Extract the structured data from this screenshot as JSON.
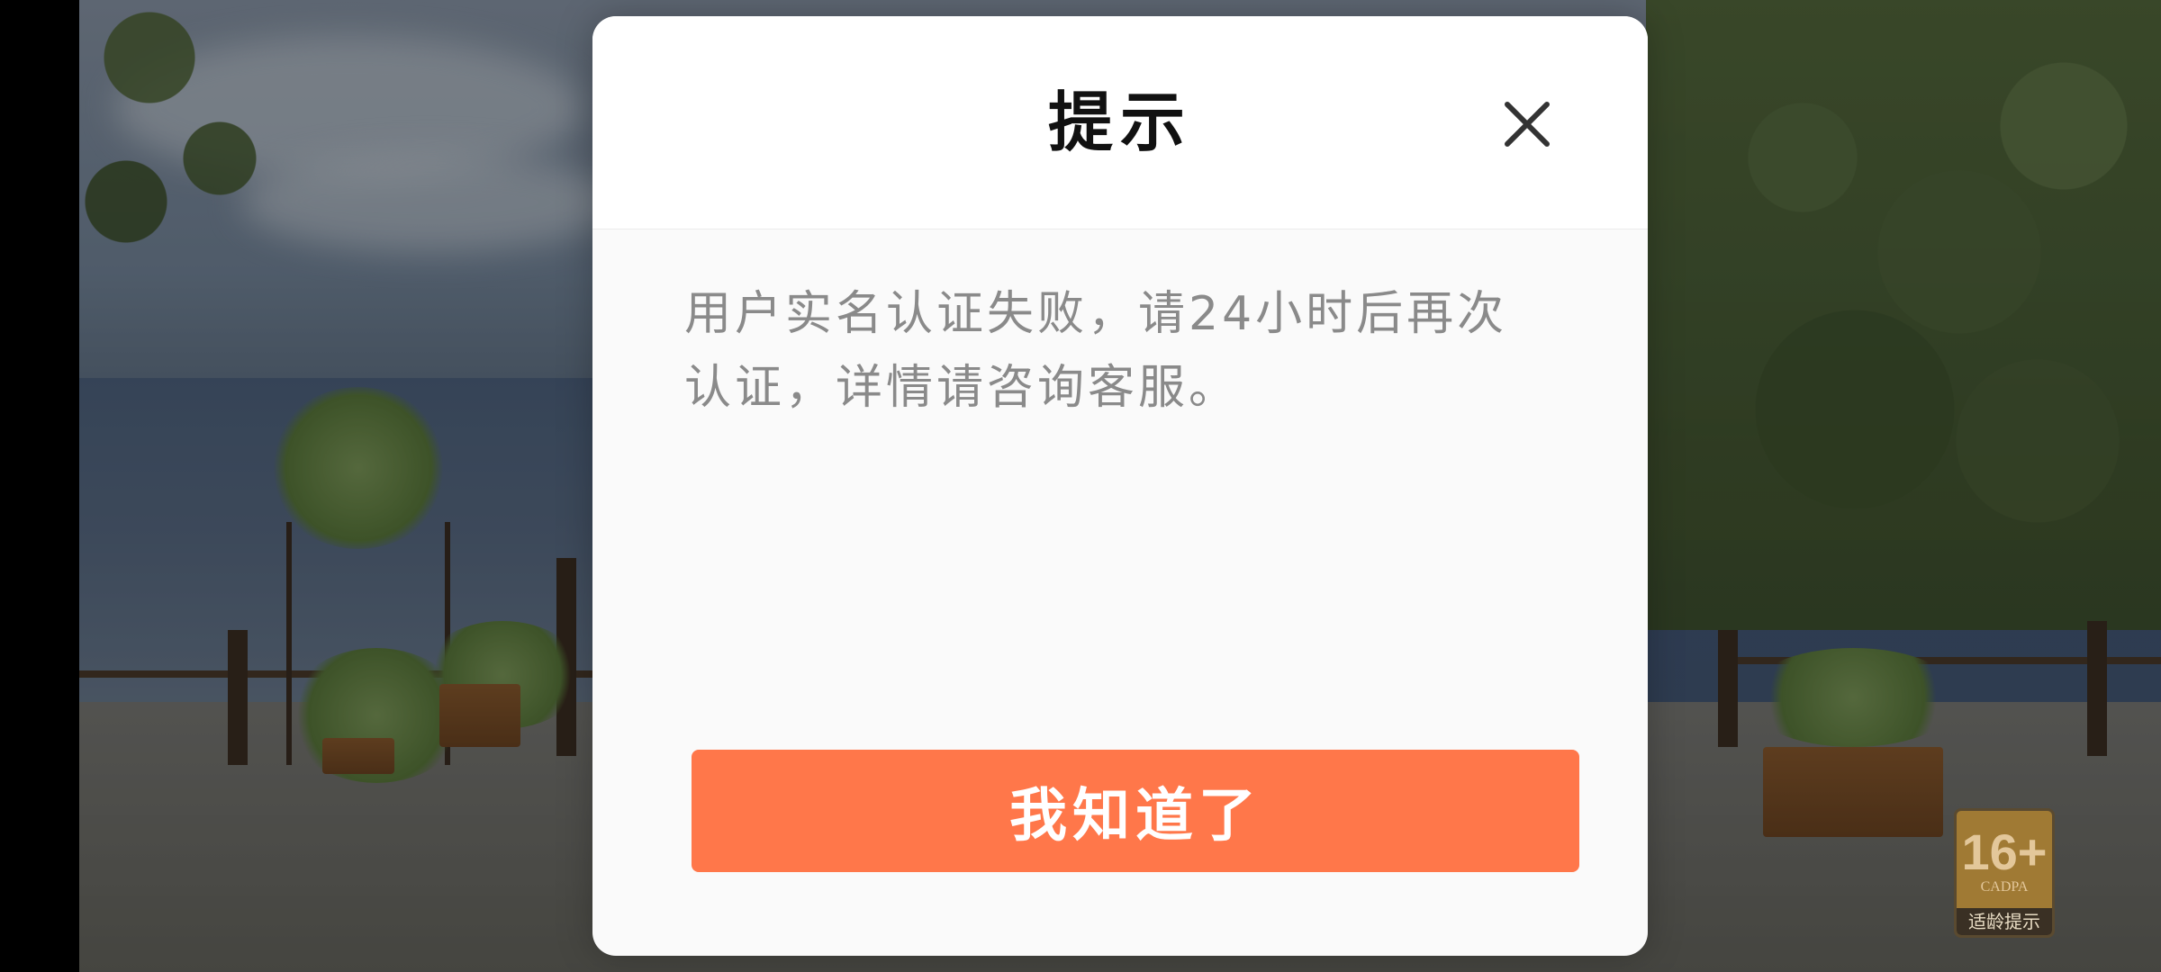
{
  "dialog": {
    "title": "提示",
    "message": "用户实名认证失败，请24小时后再次认证，详情请咨询客服。",
    "confirm_label": "我知道了"
  },
  "rating_badge": {
    "age": "16+",
    "org": "CADPA",
    "note": "适龄提示"
  },
  "colors": {
    "accent": "#ff774a",
    "title_text": "#111111",
    "message_text": "#8a8a8a",
    "dialog_background": "#fafafa"
  },
  "icons": {
    "close": "close-icon"
  }
}
